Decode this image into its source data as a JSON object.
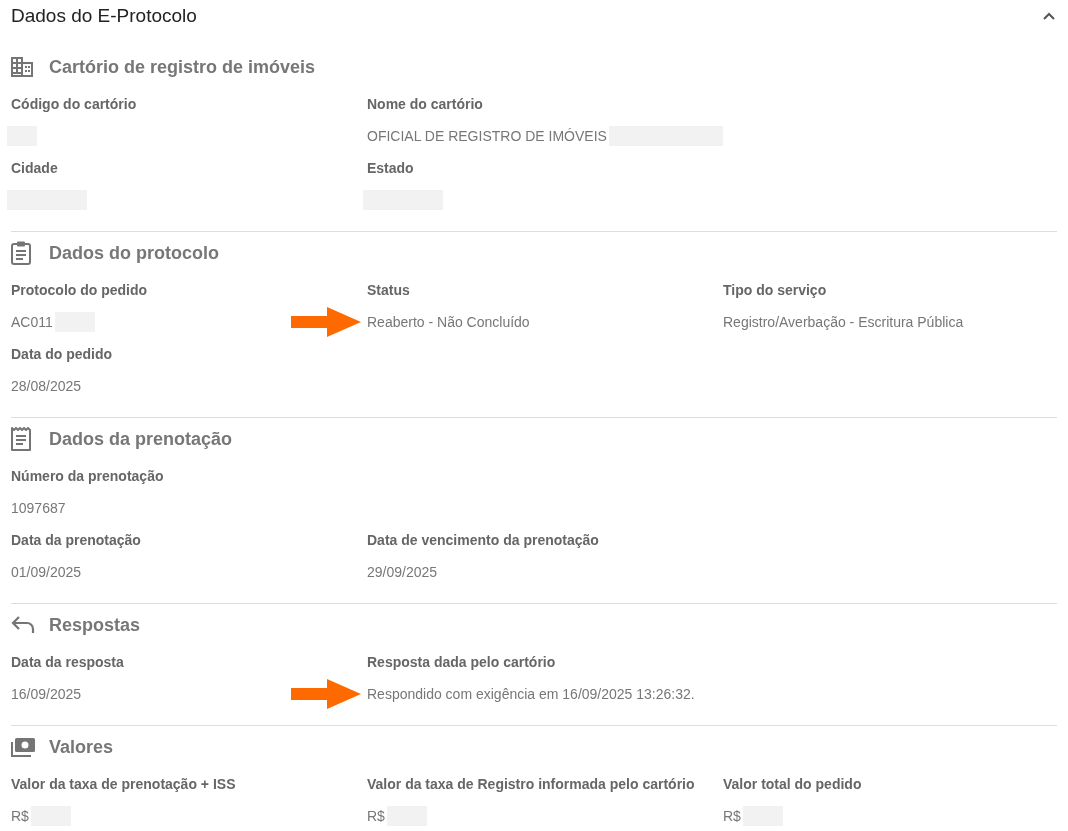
{
  "panel": {
    "title": "Dados do E-Protocolo",
    "expanded": true
  },
  "sections": [
    {
      "title": "Cartório de registro de imóveis",
      "rows": [
        [
          {
            "label": "Código do cartório",
            "redacted": true
          },
          {
            "label": "Nome do cartório",
            "value": "OFICIAL DE REGISTRO DE IMÓVEIS",
            "redacted": true
          }
        ],
        [
          {
            "label": "Cidade",
            "redacted": true
          },
          {
            "label": "Estado",
            "redacted": true
          }
        ]
      ]
    },
    {
      "title": "Dados do protocolo",
      "rows": [
        [
          {
            "label": "Protocolo do pedido",
            "value": "AC011",
            "redacted": true
          },
          {
            "label": "Status",
            "value": "Reaberto - Não Concluído",
            "arrow": true
          },
          {
            "label": "Tipo do serviço",
            "value": "Registro/Averbação - Escritura Pública"
          }
        ],
        [
          {
            "label": "Data do pedido",
            "value": "28/08/2025"
          }
        ]
      ]
    },
    {
      "title": "Dados da prenotação",
      "rows": [
        [
          {
            "label": "Número da prenotação",
            "value": "1097687"
          }
        ],
        [
          {
            "label": "Data da prenotação",
            "value": "01/09/2025"
          },
          {
            "label": "Data de vencimento da prenotação",
            "value": "29/09/2025"
          }
        ]
      ]
    },
    {
      "title": "Respostas",
      "rows": [
        [
          {
            "label": "Data da resposta",
            "value": "16/09/2025"
          },
          {
            "label": "Resposta dada pelo cartório",
            "value": "Respondido com exigência em 16/09/2025 13:26:32.",
            "arrow": true
          }
        ]
      ]
    },
    {
      "title": "Valores",
      "rows": [
        [
          {
            "label": "Valor da taxa de prenotação + ISS",
            "value": "R$",
            "redacted": true
          },
          {
            "label": "Valor da taxa de Registro informada pelo cartório",
            "value": "R$",
            "redacted": true
          },
          {
            "label": "Valor total do pedido",
            "value": "R$",
            "redacted": true
          }
        ]
      ]
    }
  ]
}
